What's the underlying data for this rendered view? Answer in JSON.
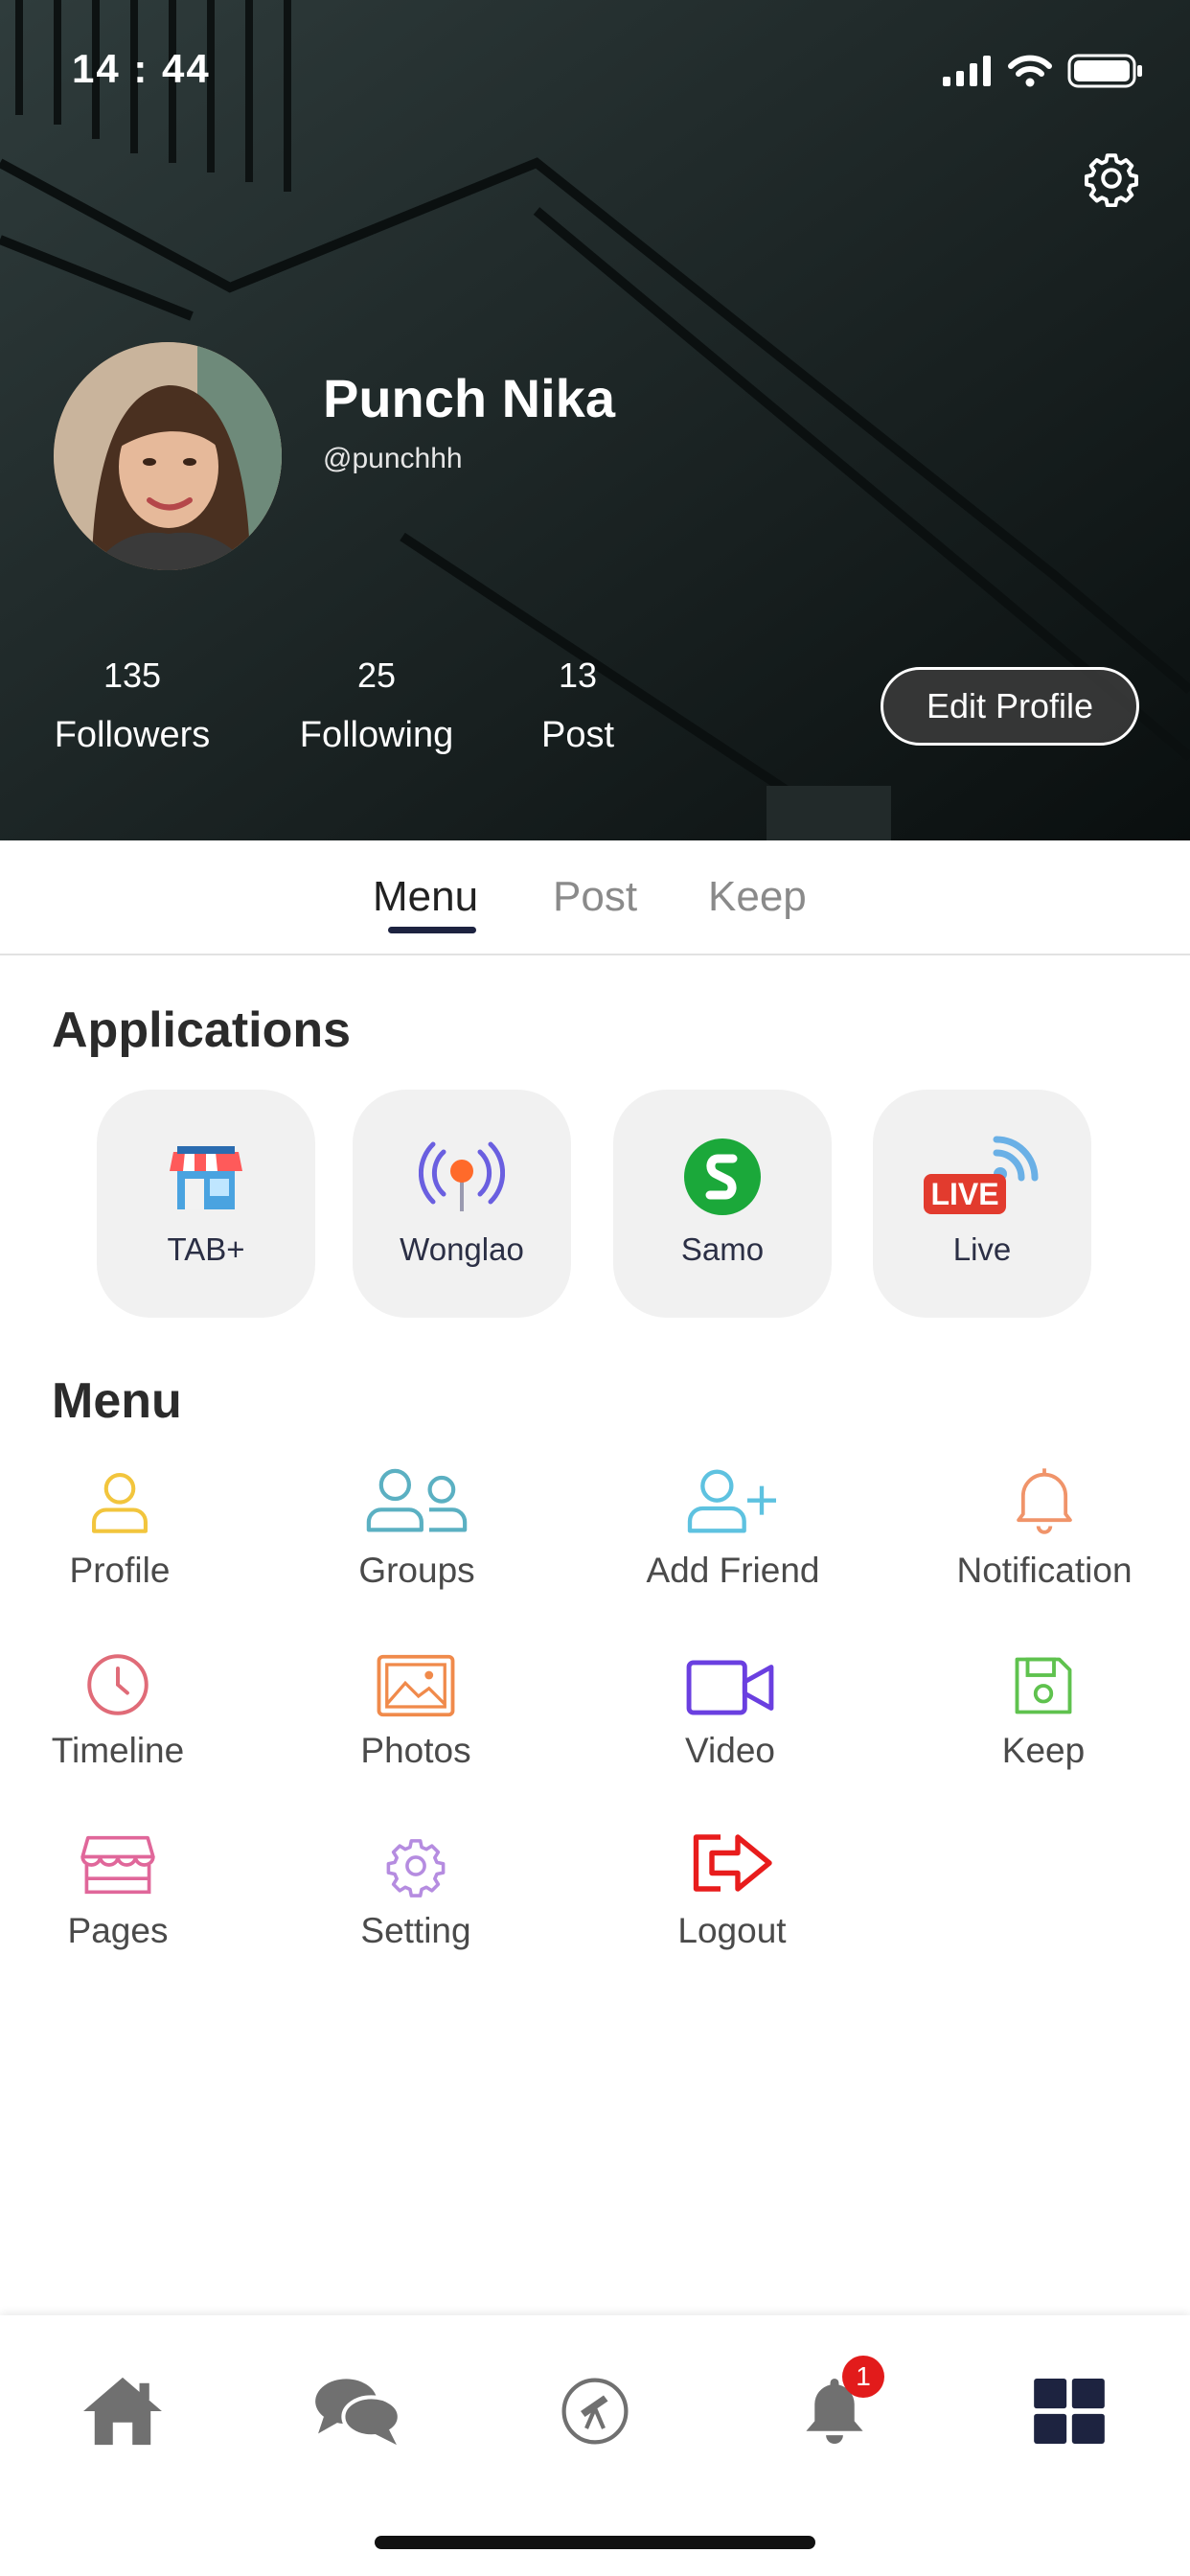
{
  "status_bar": {
    "time": "14 : 44"
  },
  "profile": {
    "name": "Punch Nika",
    "handle": "@punchhh",
    "stats": [
      {
        "value": "135",
        "label": "Followers"
      },
      {
        "value": "25",
        "label": "Following"
      },
      {
        "value": "13",
        "label": "Post"
      }
    ],
    "edit_label": "Edit Profile"
  },
  "tabs": [
    {
      "label": "Menu",
      "active": true
    },
    {
      "label": "Post",
      "active": false
    },
    {
      "label": "Keep",
      "active": false
    }
  ],
  "applications": {
    "title": "Applications",
    "items": [
      {
        "label": "TAB+",
        "icon": "shop-icon"
      },
      {
        "label": "Wonglao",
        "icon": "broadcast-icon"
      },
      {
        "label": "Samo",
        "icon": "samo-icon"
      },
      {
        "label": "Live",
        "icon": "live-icon"
      }
    ]
  },
  "menu": {
    "title": "Menu",
    "items": [
      {
        "label": "Profile",
        "icon": "user-icon",
        "color": "#f2c53d"
      },
      {
        "label": "Groups",
        "icon": "group-icon",
        "color": "#5bb0c2"
      },
      {
        "label": "Add Friend",
        "icon": "add-user-icon",
        "color": "#5ec2e0"
      },
      {
        "label": "Notification",
        "icon": "bell-icon",
        "color": "#f0946a"
      },
      {
        "label": "Timeline",
        "icon": "clock-icon",
        "color": "#e06b78"
      },
      {
        "label": "Photos",
        "icon": "image-icon",
        "color": "#f08a4b"
      },
      {
        "label": "Video",
        "icon": "video-icon",
        "color": "#6a3fe0"
      },
      {
        "label": "Keep",
        "icon": "save-icon",
        "color": "#5fc24e"
      },
      {
        "label": "Pages",
        "icon": "store-icon",
        "color": "#e0679a"
      },
      {
        "label": "Setting",
        "icon": "settings-icon",
        "color": "#b58ce0"
      },
      {
        "label": "Logout",
        "icon": "logout-icon",
        "color": "#e81c1c"
      }
    ]
  },
  "bottom_nav": {
    "items": [
      "home-icon",
      "chat-icon",
      "explore-icon",
      "notification-icon",
      "menu-grid-icon"
    ],
    "notification_badge": "1"
  }
}
